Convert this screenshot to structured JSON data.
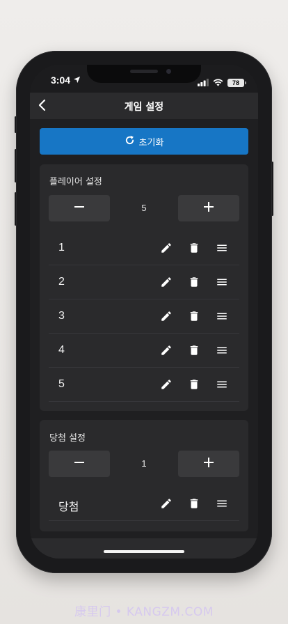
{
  "status": {
    "time": "3:04",
    "battery": "78"
  },
  "header": {
    "title": "게임 설정"
  },
  "reset": {
    "label": "초기화"
  },
  "players": {
    "title": "플레이어 설정",
    "count": "5",
    "items": [
      {
        "label": "1"
      },
      {
        "label": "2"
      },
      {
        "label": "3"
      },
      {
        "label": "4"
      },
      {
        "label": "5"
      }
    ]
  },
  "winners": {
    "title": "당첨 설정",
    "count": "1",
    "items": [
      {
        "label": "당첨"
      }
    ]
  },
  "watermark": "康里门 • KANGZM.COM",
  "colors": {
    "accent": "#1776c5",
    "surface": "#2a2a2c",
    "background": "#1f1f21"
  },
  "icons": {
    "back": "chevron-left-icon",
    "location": "location-arrow-icon",
    "reset": "refresh-icon",
    "minus": "minus-icon",
    "plus": "plus-icon",
    "edit": "pencil-icon",
    "delete": "trash-icon",
    "reorder": "hamburger-icon"
  }
}
